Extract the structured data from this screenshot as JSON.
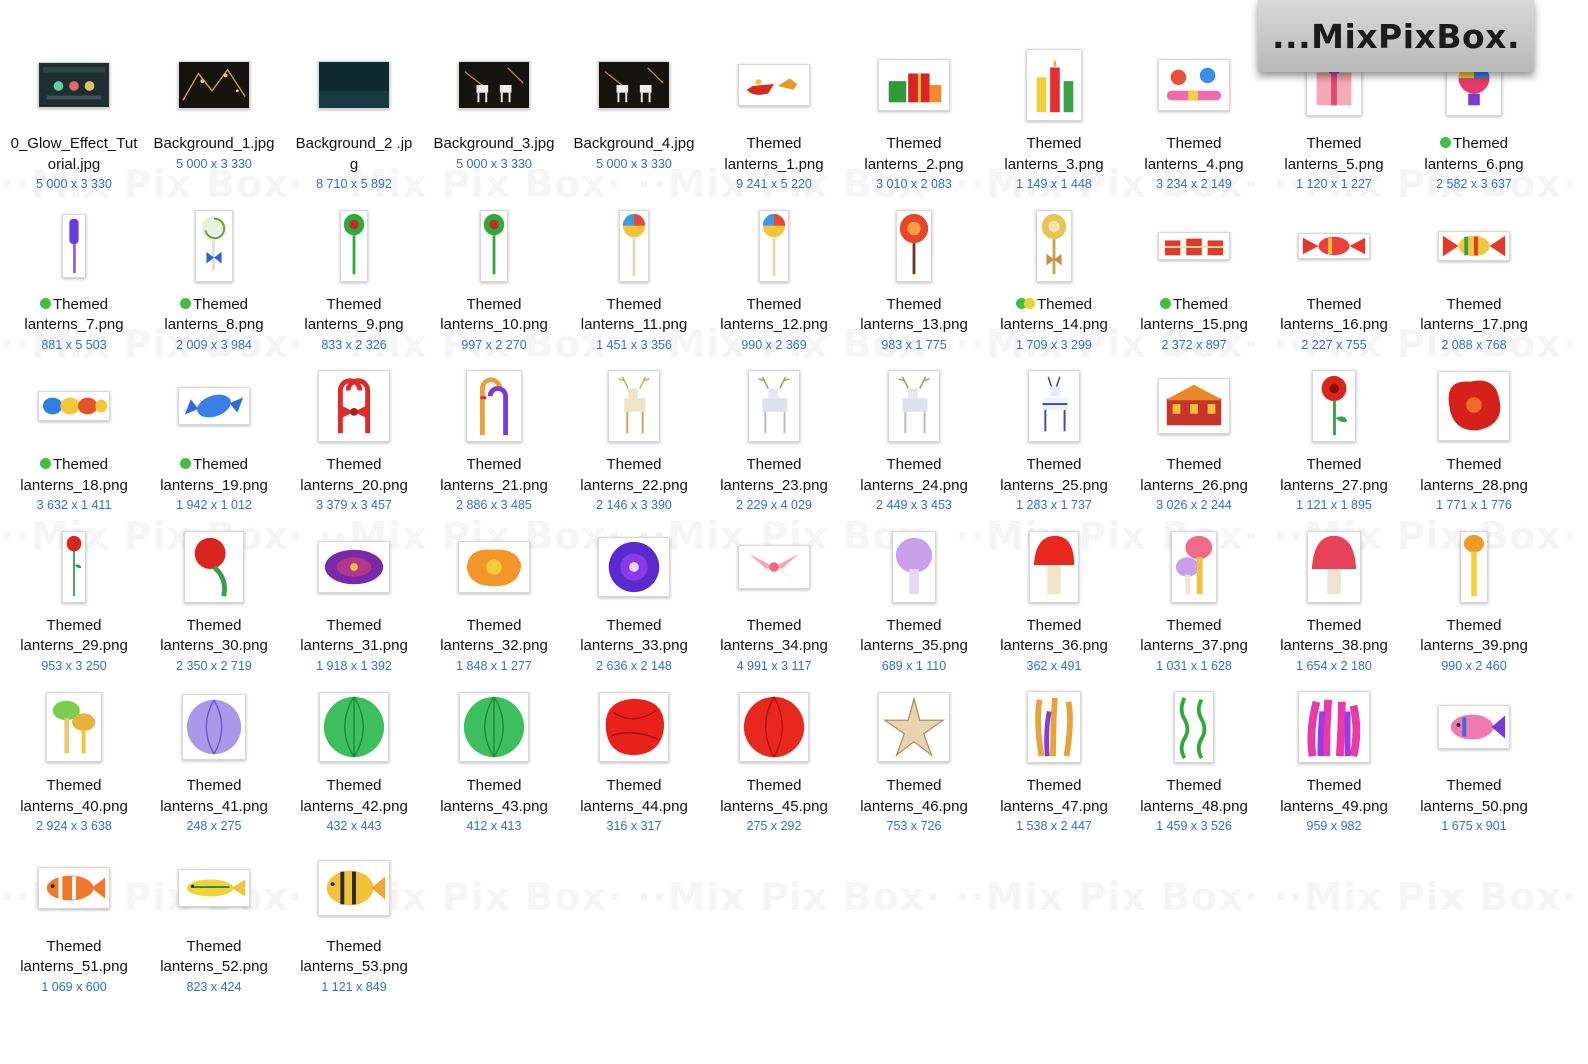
{
  "watermark_text": "··Mix Pix Box·",
  "logo": {
    "text": "...MixPixBox."
  },
  "tag_colors": {
    "green": "#3fbf4a",
    "yellow": "#e6d23a"
  },
  "files": [
    {
      "name_lines": [
        "0_Glow_Effect_Tut",
        "orial.jpg"
      ],
      "dims": "5 000 x 3 330",
      "icon": "tutorial-thumbnail-icon",
      "tags": [],
      "kind": "dark-tutorial"
    },
    {
      "name_lines": [
        "Background_1.jpg"
      ],
      "dims": "5 000 x 3 330",
      "icon": "background-thumbnail-icon",
      "tags": [],
      "kind": "dark-gold"
    },
    {
      "name_lines": [
        "Background_2 .jp",
        "g"
      ],
      "dims": "8 710 x 5 892",
      "icon": "background-thumbnail-icon",
      "tags": [],
      "kind": "dark-teal"
    },
    {
      "name_lines": [
        "Background_3.jpg"
      ],
      "dims": "5 000 x 3 330",
      "icon": "background-thumbnail-icon",
      "tags": [],
      "kind": "dark-deer"
    },
    {
      "name_lines": [
        "Background_4.jpg"
      ],
      "dims": "5 000 x 3 330",
      "icon": "background-thumbnail-icon",
      "tags": [],
      "kind": "dark-deer"
    },
    {
      "name_lines": [
        "Themed",
        "lanterns_1.png"
      ],
      "dims": "9 241 x 5 220",
      "icon": "sleigh-lantern-icon",
      "tags": [],
      "kind": "sleigh"
    },
    {
      "name_lines": [
        "Themed",
        "lanterns_2.png"
      ],
      "dims": "3 010 x 2 083",
      "icon": "gift-boxes-lantern-icon",
      "tags": [],
      "kind": "gifts"
    },
    {
      "name_lines": [
        "Themed",
        "lanterns_3.png"
      ],
      "dims": "1 149 x 1 448",
      "icon": "candles-lantern-icon",
      "tags": [],
      "kind": "candles"
    },
    {
      "name_lines": [
        "Themed",
        "lanterns_4.png"
      ],
      "dims": "3 234 x 2 149",
      "icon": "candies-lantern-icon",
      "tags": [],
      "kind": "candies"
    },
    {
      "name_lines": [
        "Themed",
        "lanterns_5.png"
      ],
      "dims": "1 120 x 1 227",
      "icon": "gift-lantern-icon",
      "tags": [],
      "kind": "gift-pink"
    },
    {
      "name_lines": [
        "Themed",
        "lanterns_6.png"
      ],
      "dims": "2 582 x 3 637",
      "icon": "balloon-gift-lantern-icon",
      "tags": [
        "green"
      ],
      "kind": "balloon"
    },
    {
      "name_lines": [
        "Themed",
        "lanterns_7.png"
      ],
      "dims": "881 x 5 503",
      "icon": "candy-stick-lantern-icon",
      "tags": [
        "green"
      ],
      "kind": "stick-purple"
    },
    {
      "name_lines": [
        "Themed",
        "lanterns_8.png"
      ],
      "dims": "2 009 x 3 984",
      "icon": "lollipop-lantern-icon",
      "tags": [
        "green"
      ],
      "kind": "lolly-swirl-blue"
    },
    {
      "name_lines": [
        "Themed",
        "lanterns_9.png"
      ],
      "dims": "833 x 2 326",
      "icon": "lollipop-lantern-icon",
      "tags": [],
      "kind": "lolly-green"
    },
    {
      "name_lines": [
        "Themed",
        "lanterns_10.png"
      ],
      "dims": "997 x 2 270",
      "icon": "lollipop-lantern-icon",
      "tags": [],
      "kind": "lolly-green"
    },
    {
      "name_lines": [
        "Themed",
        "lanterns_11.png"
      ],
      "dims": "1 451 x 3 356",
      "icon": "lollipop-lantern-icon",
      "tags": [],
      "kind": "lolly-rainbow"
    },
    {
      "name_lines": [
        "Themed",
        "lanterns_12.png"
      ],
      "dims": "990 x 2 369",
      "icon": "lollipop-lantern-icon",
      "tags": [],
      "kind": "lolly-rainbow"
    },
    {
      "name_lines": [
        "Themed",
        "lanterns_13.png"
      ],
      "dims": "983 x 1 775",
      "icon": "lollipop-lantern-icon",
      "tags": [],
      "kind": "lolly-red"
    },
    {
      "name_lines": [
        "Themed",
        "lanterns_14.png"
      ],
      "dims": "1 709 x 3 299",
      "icon": "lollipop-lantern-icon",
      "tags": [
        "green",
        "yellow"
      ],
      "kind": "lolly-gold"
    },
    {
      "name_lines": [
        "Themed",
        "lanterns_15.png"
      ],
      "dims": "2 372 x 897",
      "icon": "gift-row-lantern-icon",
      "tags": [
        "green"
      ],
      "kind": "gift-row"
    },
    {
      "name_lines": [
        "Themed",
        "lanterns_16.png"
      ],
      "dims": "2 227 x 755",
      "icon": "wrapped-candy-lantern-icon",
      "tags": [],
      "kind": "candy-red"
    },
    {
      "name_lines": [
        "Themed",
        "lanterns_17.png"
      ],
      "dims": "2 088 x 768",
      "icon": "wrapped-candy-lantern-icon",
      "tags": [],
      "kind": "candy-stripe"
    },
    {
      "name_lines": [
        "Themed",
        "lanterns_18.png"
      ],
      "dims": "3 632 x 1 411",
      "icon": "wrapped-candy-lantern-icon",
      "tags": [
        "green"
      ],
      "kind": "candy-multi"
    },
    {
      "name_lines": [
        "Themed",
        "lanterns_19.png"
      ],
      "dims": "1 942 x 1 012",
      "icon": "wrapped-candy-lantern-icon",
      "tags": [
        "green"
      ],
      "kind": "candy-blue"
    },
    {
      "name_lines": [
        "Themed",
        "lanterns_20.png"
      ],
      "dims": "3 379 x 3 457",
      "icon": "candy-cane-bow-lantern-icon",
      "tags": [],
      "kind": "canes-bow"
    },
    {
      "name_lines": [
        "Themed",
        "lanterns_21.png"
      ],
      "dims": "2 886 x 3 485",
      "icon": "candy-cane-lantern-icon",
      "tags": [],
      "kind": "canes"
    },
    {
      "name_lines": [
        "Themed",
        "lanterns_22.png"
      ],
      "dims": "2 146 x 3 390",
      "icon": "deer-lantern-icon",
      "tags": [],
      "kind": "deer-gold"
    },
    {
      "name_lines": [
        "Themed",
        "lanterns_23.png"
      ],
      "dims": "2 229 x 4 029",
      "icon": "deer-lantern-icon",
      "tags": [],
      "kind": "deer-white"
    },
    {
      "name_lines": [
        "Themed",
        "lanterns_24.png"
      ],
      "dims": "2 449 x 3 453",
      "icon": "deer-lantern-icon",
      "tags": [],
      "kind": "deer-white"
    },
    {
      "name_lines": [
        "Themed",
        "lanterns_25.png"
      ],
      "dims": "1 283 x 1 737",
      "icon": "deer-lantern-icon",
      "tags": [],
      "kind": "deer-blue"
    },
    {
      "name_lines": [
        "Themed",
        "lanterns_26.png"
      ],
      "dims": "3 026 x 2 244",
      "icon": "gingerbread-house-lantern-icon",
      "tags": [],
      "kind": "house"
    },
    {
      "name_lines": [
        "Themed",
        "lanterns_27.png"
      ],
      "dims": "1 121 x 1 895",
      "icon": "flower-lantern-icon",
      "tags": [],
      "kind": "flower-red-stem"
    },
    {
      "name_lines": [
        "Themed",
        "lanterns_28.png"
      ],
      "dims": "1 771 x 1 776",
      "icon": "flower-lantern-icon",
      "tags": [],
      "kind": "flower-red-big"
    },
    {
      "name_lines": [
        "Themed",
        "lanterns_29.png"
      ],
      "dims": "953 x 3 250",
      "icon": "flower-lantern-icon",
      "tags": [],
      "kind": "flower-small-stem"
    },
    {
      "name_lines": [
        "Themed",
        "lanterns_30.png"
      ],
      "dims": "2 350 x 2 719",
      "icon": "flower-lantern-icon",
      "tags": [],
      "kind": "flower-red-curve"
    },
    {
      "name_lines": [
        "Themed",
        "lanterns_31.png"
      ],
      "dims": "1 918 x 1 392",
      "icon": "flower-lantern-icon",
      "tags": [],
      "kind": "flower-purple"
    },
    {
      "name_lines": [
        "Themed",
        "lanterns_32.png"
      ],
      "dims": "1 848 x 1 277",
      "icon": "flower-lantern-icon",
      "tags": [],
      "kind": "flower-orange"
    },
    {
      "name_lines": [
        "Themed",
        "lanterns_33.png"
      ],
      "dims": "2 636 x 2 148",
      "icon": "flower-lantern-icon",
      "tags": [],
      "kind": "flower-violet"
    },
    {
      "name_lines": [
        "Themed",
        "lanterns_34.png"
      ],
      "dims": "4 991 x 3 117",
      "icon": "lily-lantern-icon",
      "tags": [],
      "kind": "flower-pink"
    },
    {
      "name_lines": [
        "Themed",
        "lanterns_35.png"
      ],
      "dims": "689 x 1 110",
      "icon": "mushroom-lantern-icon",
      "tags": [],
      "kind": "mush-purple"
    },
    {
      "name_lines": [
        "Themed",
        "lanterns_36.png"
      ],
      "dims": "362 x 491",
      "icon": "mushroom-lantern-icon",
      "tags": [],
      "kind": "mush-red"
    },
    {
      "name_lines": [
        "Themed",
        "lanterns_37.png"
      ],
      "dims": "1 031 x 1 628",
      "icon": "mushroom-lantern-icon",
      "tags": [],
      "kind": "mush-multi"
    },
    {
      "name_lines": [
        "Themed",
        "lanterns_38.png"
      ],
      "dims": "1 654 x 2 180",
      "icon": "mushroom-lantern-icon",
      "tags": [],
      "kind": "mush-pink"
    },
    {
      "name_lines": [
        "Themed",
        "lanterns_39.png"
      ],
      "dims": "990 x 2 460",
      "icon": "mushroom-lantern-icon",
      "tags": [],
      "kind": "mush-tall"
    },
    {
      "name_lines": [
        "Themed",
        "lanterns_40.png"
      ],
      "dims": "2 924 x 3 638",
      "icon": "mushroom-lantern-icon",
      "tags": [],
      "kind": "mush-green"
    },
    {
      "name_lines": [
        "Themed",
        "lanterns_41.png"
      ],
      "dims": "248 x 275",
      "icon": "ball-lantern-icon",
      "tags": [],
      "kind": "ball-lilac"
    },
    {
      "name_lines": [
        "Themed",
        "lanterns_42.png"
      ],
      "dims": "432 x 443",
      "icon": "ball-lantern-icon",
      "tags": [],
      "kind": "ball-green"
    },
    {
      "name_lines": [
        "Themed",
        "lanterns_43.png"
      ],
      "dims": "412 x 413",
      "icon": "ball-lantern-icon",
      "tags": [],
      "kind": "ball-green"
    },
    {
      "name_lines": [
        "Themed",
        "lanterns_44.png"
      ],
      "dims": "316 x 317",
      "icon": "ball-lantern-icon",
      "tags": [],
      "kind": "ball-red-flat"
    },
    {
      "name_lines": [
        "Themed",
        "lanterns_45.png"
      ],
      "dims": "275 x 292",
      "icon": "ball-lantern-icon",
      "tags": [],
      "kind": "ball-red"
    },
    {
      "name_lines": [
        "Themed",
        "lanterns_46.png"
      ],
      "dims": "753 x 726",
      "icon": "starfish-lantern-icon",
      "tags": [],
      "kind": "starfish"
    },
    {
      "name_lines": [
        "Themed",
        "lanterns_47.png"
      ],
      "dims": "1 538 x 2 447",
      "icon": "coral-lantern-icon",
      "tags": [],
      "kind": "coral"
    },
    {
      "name_lines": [
        "Themed",
        "lanterns_48.png"
      ],
      "dims": "1 459 x 3 526",
      "icon": "seaweed-lantern-icon",
      "tags": [],
      "kind": "seaweed"
    },
    {
      "name_lines": [
        "Themed",
        "lanterns_49.png"
      ],
      "dims": "959 x 982",
      "icon": "anemone-lantern-icon",
      "tags": [],
      "kind": "anemone"
    },
    {
      "name_lines": [
        "Themed",
        "lanterns_50.png"
      ],
      "dims": "1 675 x 901",
      "icon": "fish-lantern-icon",
      "tags": [],
      "kind": "fish-pink"
    },
    {
      "name_lines": [
        "Themed",
        "lanterns_51.png"
      ],
      "dims": "1 069 x 600",
      "icon": "fish-lantern-icon",
      "tags": [],
      "kind": "fish-clown"
    },
    {
      "name_lines": [
        "Themed",
        "lanterns_52.png"
      ],
      "dims": "823 x 424",
      "icon": "fish-lantern-icon",
      "tags": [],
      "kind": "fish-yellow"
    },
    {
      "name_lines": [
        "Themed",
        "lanterns_53.png"
      ],
      "dims": "1 121 x 849",
      "icon": "fish-lantern-icon",
      "tags": [],
      "kind": "fish-striped"
    }
  ]
}
